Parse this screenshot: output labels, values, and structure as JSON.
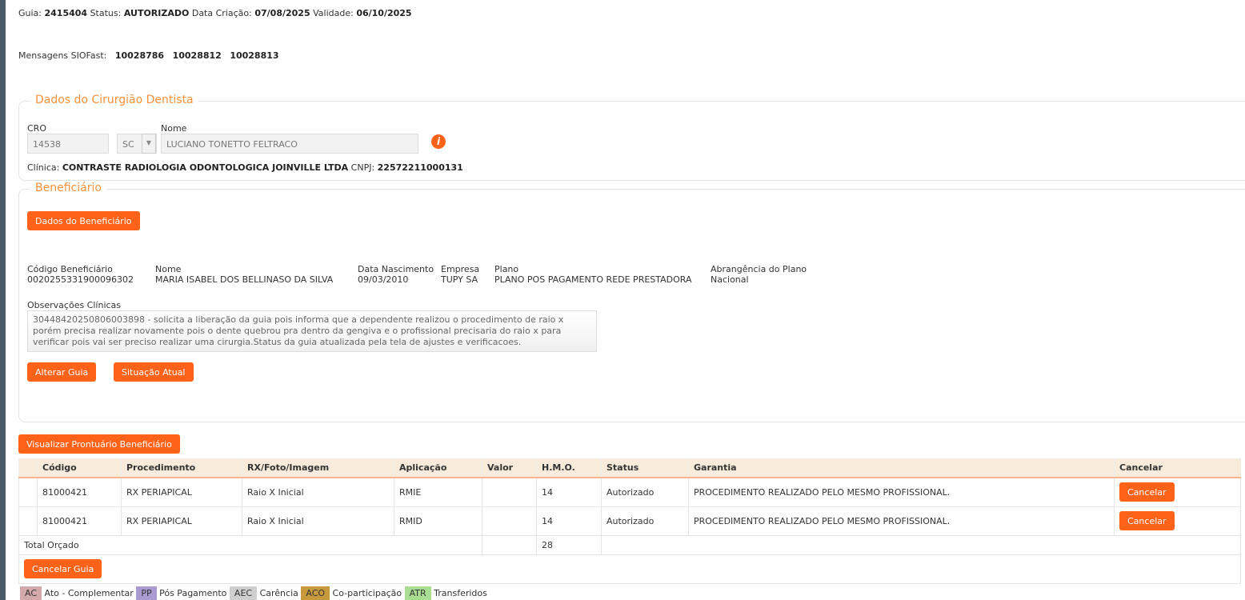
{
  "header": {
    "guia_label": "Guia:",
    "guia": "2415404",
    "status_label": "Status:",
    "status": "AUTORIZADO",
    "criacao_label": "Data Criação:",
    "criacao": "07/08/2025",
    "validade_label": "Validade:",
    "validade": "06/10/2025"
  },
  "mensagens": {
    "label": "Mensagens SIOFast:",
    "ids": [
      "10028786",
      "10028812",
      "10028813"
    ]
  },
  "dentista": {
    "legend": "Dados do Cirurgião Dentista",
    "cro_label": "CRO",
    "cro": "14538",
    "uf": "SC",
    "nome_label": "Nome",
    "nome": "LUCIANO TONETTO FELTRACO",
    "clinica_label": "Clínica:",
    "clinica": "CONTRASTE RADIOLOGIA ODONTOLOGICA JOINVILLE LTDA",
    "cnpj_label": "CNPJ:",
    "cnpj": "22572211000131"
  },
  "beneficiario": {
    "legend": "Beneficiário",
    "dados_btn": "Dados do Beneficiário",
    "fields": [
      {
        "label": "Código Beneficiário",
        "value": "0020255331900096302"
      },
      {
        "label": "Nome",
        "value": "MARIA ISABEL DOS BELLINASO DA SILVA"
      },
      {
        "label": "Data Nascimento",
        "value": "09/03/2010"
      },
      {
        "label": "Empresa",
        "value": "TUPY SA"
      },
      {
        "label": "Plano",
        "value": "PLANO POS PAGAMENTO REDE PRESTADORA"
      },
      {
        "label": "Abrangência do Plano",
        "value": "Nacional"
      }
    ],
    "obs_label": "Observações Clínicas",
    "obs": "3044842025080600389８ - solicita a liberação da guia pois informa que a dependente realizou o procedimento de raio x porém precisa realizar novamente pois o dente quebrou pra dentro da gengiva e o profissional precisaria do raio x para verificar pois vai ser preciso realizar uma cirurgia.Status da guia atualizada pela tela de ajustes e verificacoes.",
    "alterar_btn": "Alterar Guia",
    "situacao_btn": "Situação Atual"
  },
  "prontuario_btn": "Visualizar Prontuário Beneficiário",
  "table": {
    "headers": [
      "",
      "Código",
      "Procedimento",
      "RX/Foto/Imagem",
      "Aplicação",
      "Valor",
      "H.M.O.",
      "Status",
      "Garantia",
      "Cancelar"
    ],
    "rows": [
      [
        "",
        "81000421",
        "RX PERIAPICAL",
        "Raio X Inicial",
        "RMIE",
        "",
        "14",
        "Autorizado",
        "PROCEDIMENTO REALIZADO PELO MESMO PROFISSIONAL.",
        "Cancelar"
      ],
      [
        "",
        "81000421",
        "RX PERIAPICAL",
        "Raio X Inicial",
        "RMID",
        "",
        "14",
        "Autorizado",
        "PROCEDIMENTO REALIZADO PELO MESMO PROFISSIONAL.",
        "Cancelar"
      ]
    ],
    "total_label": "Total Orçado",
    "total_hmo": "28"
  },
  "cancelar_guia_btn": "Cancelar Guia",
  "legend_items": [
    {
      "code": "AC",
      "label": "Ato - Complementar",
      "color": "#d4a9a9"
    },
    {
      "code": "PP",
      "label": "Pós Pagamento",
      "color": "#a99bd1"
    },
    {
      "code": "AEC",
      "label": "Carência",
      "color": "#cfcfcf"
    },
    {
      "code": "ACO",
      "label": "Co-participação",
      "color": "#c99a3d"
    },
    {
      "code": "ATR",
      "label": "Transferidos",
      "color": "#a9dd92"
    }
  ]
}
